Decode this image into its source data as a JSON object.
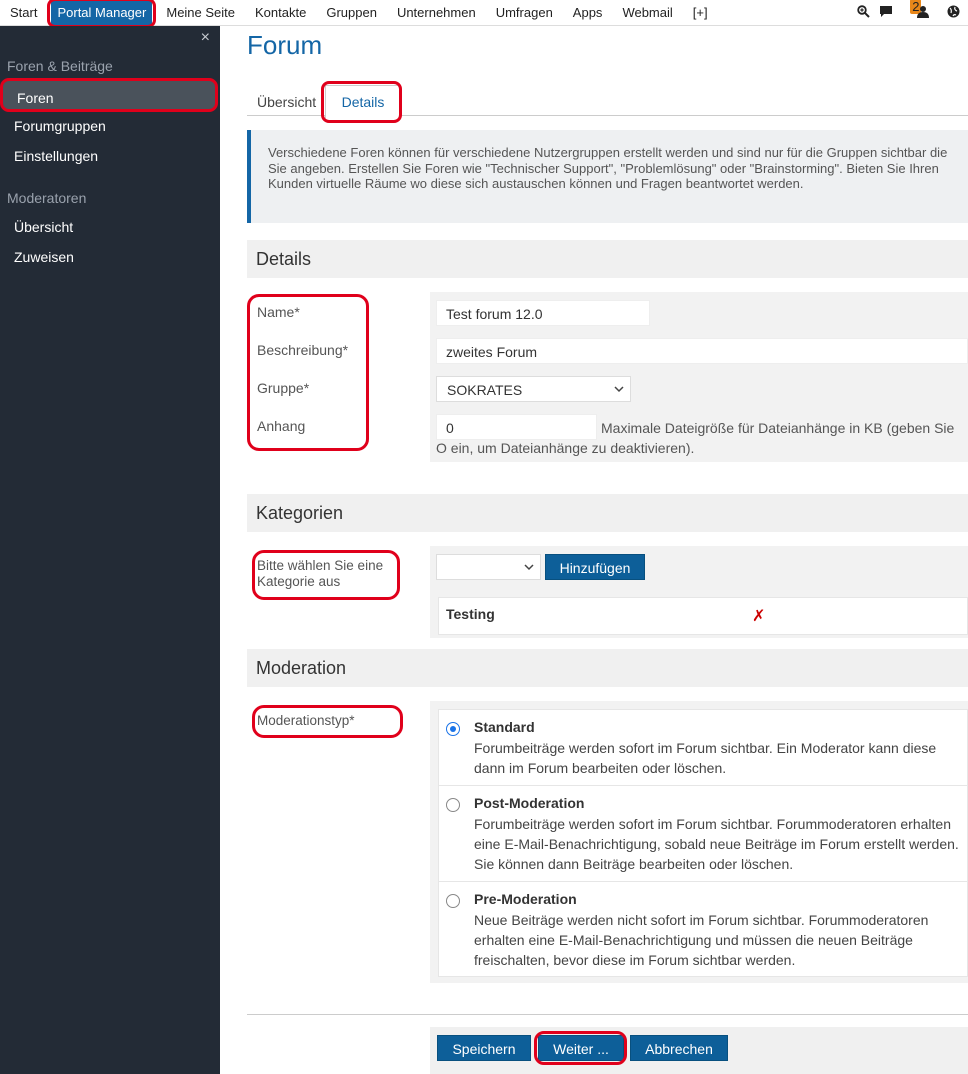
{
  "topnav": {
    "items": [
      "Start",
      "Portal Manager",
      "Meine Seite",
      "Kontakte",
      "Gruppen",
      "Unternehmen",
      "Umfragen",
      "Apps",
      "Webmail",
      "[+]"
    ],
    "badge_count": "2",
    "icons": [
      "search-zoom-icon",
      "chat-icon",
      "user-icon",
      "globe-icon"
    ]
  },
  "sidebar": {
    "close": "×",
    "section1": "Foren & Beiträge",
    "items1": [
      "Foren",
      "Forumgruppen",
      "Einstellungen"
    ],
    "section2": "Moderatoren",
    "items2": [
      "Übersicht",
      "Zuweisen"
    ]
  },
  "main": {
    "title": "Forum",
    "tabs": [
      "Übersicht",
      "Details"
    ],
    "info": "Verschiedene Foren können für verschiedene Nutzergruppen erstellt werden und sind nur für die Gruppen sichtbar die Sie angeben. Erstellen Sie Foren wie \"Technischer Support\", \"Problemlösung\" oder \"Brainstorming\". Bieten Sie Ihren Kunden virtuelle Räume wo diese sich austauschen können und Fragen beantwortet werden."
  },
  "details": {
    "heading": "Details",
    "name_label": "Name*",
    "name_value": "Test forum 12.0",
    "desc_label": "Beschreibung*",
    "desc_value": "zweites Forum",
    "group_label": "Gruppe*",
    "group_value": "SOKRATES",
    "attach_label": "Anhang",
    "attach_value": "0",
    "attach_hint": "Maximale Dateigröße für Dateianhänge in KB (geben Sie O ein, um Dateianhänge zu deaktivieren)."
  },
  "categories": {
    "heading": "Kategorien",
    "label": "Bitte wählen Sie eine Kategorie aus",
    "select_value": "",
    "add_button": "Hinzufügen",
    "items": [
      "Testing"
    ],
    "delete_glyph": "✗"
  },
  "moderation": {
    "heading": "Moderation",
    "label": "Moderationstyp*",
    "options": [
      {
        "title": "Standard",
        "desc": "Forumbeiträge werden sofort im Forum sichtbar. Ein Moderator kann diese dann im Forum bearbeiten oder löschen.",
        "checked": true
      },
      {
        "title": "Post-Moderation",
        "desc": "Forumbeiträge werden sofort im Forum sichtbar. Forummoderatoren erhalten eine E-Mail-Benachrichtigung, sobald neue Beiträge im Forum erstellt werden. Sie können dann Beiträge bearbeiten oder löschen.",
        "checked": false
      },
      {
        "title": "Pre-Moderation",
        "desc": "Neue Beiträge werden nicht sofort im Forum sichtbar. Forummoderatoren erhalten eine E-Mail-Benachrichtigung und müssen die neuen Beiträge freischalten, bevor diese im Forum sichtbar werden.",
        "checked": false
      }
    ]
  },
  "footer": {
    "save": "Speichern",
    "next": "Weiter ...",
    "cancel": "Abbrechen"
  }
}
